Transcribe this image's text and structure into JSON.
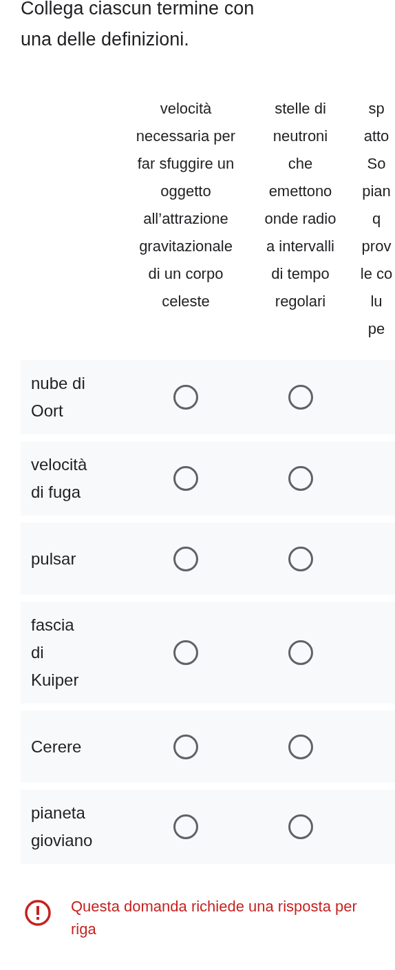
{
  "question": {
    "title": "Collega ciascun termine con una delle definizioni."
  },
  "columns": [
    {
      "label": "velocità necessaria per far sfuggire un oggetto all’attrazione gravitazionale di un corpo celeste"
    },
    {
      "label": "stelle di neutroni che emettono onde radio a intervalli di tempo regolari"
    },
    {
      "fragments": [
        "sp",
        "atto",
        "So",
        "pian",
        "q",
        "prov",
        "le co",
        "lu",
        "pe"
      ]
    }
  ],
  "rows": [
    {
      "label": "nube di Oort",
      "options": [
        {
          "selected": false
        },
        {
          "selected": false
        }
      ]
    },
    {
      "label": "velocità di fuga",
      "options": [
        {
          "selected": false
        },
        {
          "selected": false
        }
      ]
    },
    {
      "label": "pulsar",
      "options": [
        {
          "selected": false
        },
        {
          "selected": false
        }
      ]
    },
    {
      "label": "fascia di Kuiper",
      "options": [
        {
          "selected": false
        },
        {
          "selected": false
        }
      ]
    },
    {
      "label": "Cerere",
      "options": [
        {
          "selected": false
        },
        {
          "selected": false
        }
      ]
    },
    {
      "label": "pianeta gioviano",
      "options": [
        {
          "selected": false
        },
        {
          "selected": false
        }
      ]
    }
  ],
  "error": {
    "text": "Questa domanda richiede una risposta per riga"
  }
}
